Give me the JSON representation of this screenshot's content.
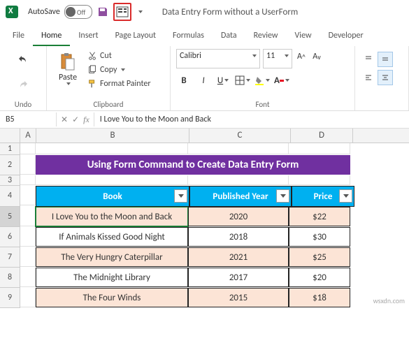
{
  "title_bar": {
    "autosave_label": "AutoSave",
    "toggle_state": "Off",
    "document_name": "Data Entry Form without a UserForm"
  },
  "menu": {
    "file": "File",
    "home": "Home",
    "insert": "Insert",
    "page_layout": "Page Layout",
    "formulas": "Formulas",
    "data": "Data",
    "review": "Review",
    "view": "View",
    "developer": "Developer"
  },
  "ribbon": {
    "undo_label": "Undo",
    "clipboard": {
      "cut": "Cut",
      "copy": "Copy",
      "format_painter": "Format Painter",
      "paste": "Paste",
      "label": "Clipboard"
    },
    "font": {
      "name": "Calibri",
      "size": "11",
      "label": "Font"
    }
  },
  "name_box": "B5",
  "formula": "I Love You to the Moon and Back",
  "columns": [
    "A",
    "B",
    "C",
    "D"
  ],
  "row_nums": [
    "1",
    "2",
    "3",
    "4",
    "5",
    "6",
    "7",
    "8",
    "9"
  ],
  "sheet": {
    "title": "Using Form Command to Create Data Entry Form",
    "headers": {
      "book": "Book",
      "year": "Published Year",
      "price": "Price"
    },
    "rows": [
      {
        "book": "I Love You to the Moon and Back",
        "year": "2020",
        "price": "$22"
      },
      {
        "book": "If Animals Kissed Good Night",
        "year": "2018",
        "price": "$30"
      },
      {
        "book": "The Very Hungry Caterpillar",
        "year": "2021",
        "price": "$25"
      },
      {
        "book": "The Midnight Library",
        "year": "2017",
        "price": "$20"
      },
      {
        "book": "The Four Winds",
        "year": "2015",
        "price": "$18"
      }
    ]
  },
  "watermark": "wsxdn.com",
  "chart_data": {
    "type": "table",
    "title": "Using Form Command to Create Data Entry Form",
    "columns": [
      "Book",
      "Published Year",
      "Price"
    ],
    "rows": [
      [
        "I Love You to the Moon and Back",
        2020,
        22
      ],
      [
        "If Animals Kissed Good Night",
        2018,
        30
      ],
      [
        "The Very Hungry Caterpillar",
        2021,
        25
      ],
      [
        "The Midnight Library",
        2017,
        20
      ],
      [
        "The Four Winds",
        2015,
        18
      ]
    ]
  }
}
